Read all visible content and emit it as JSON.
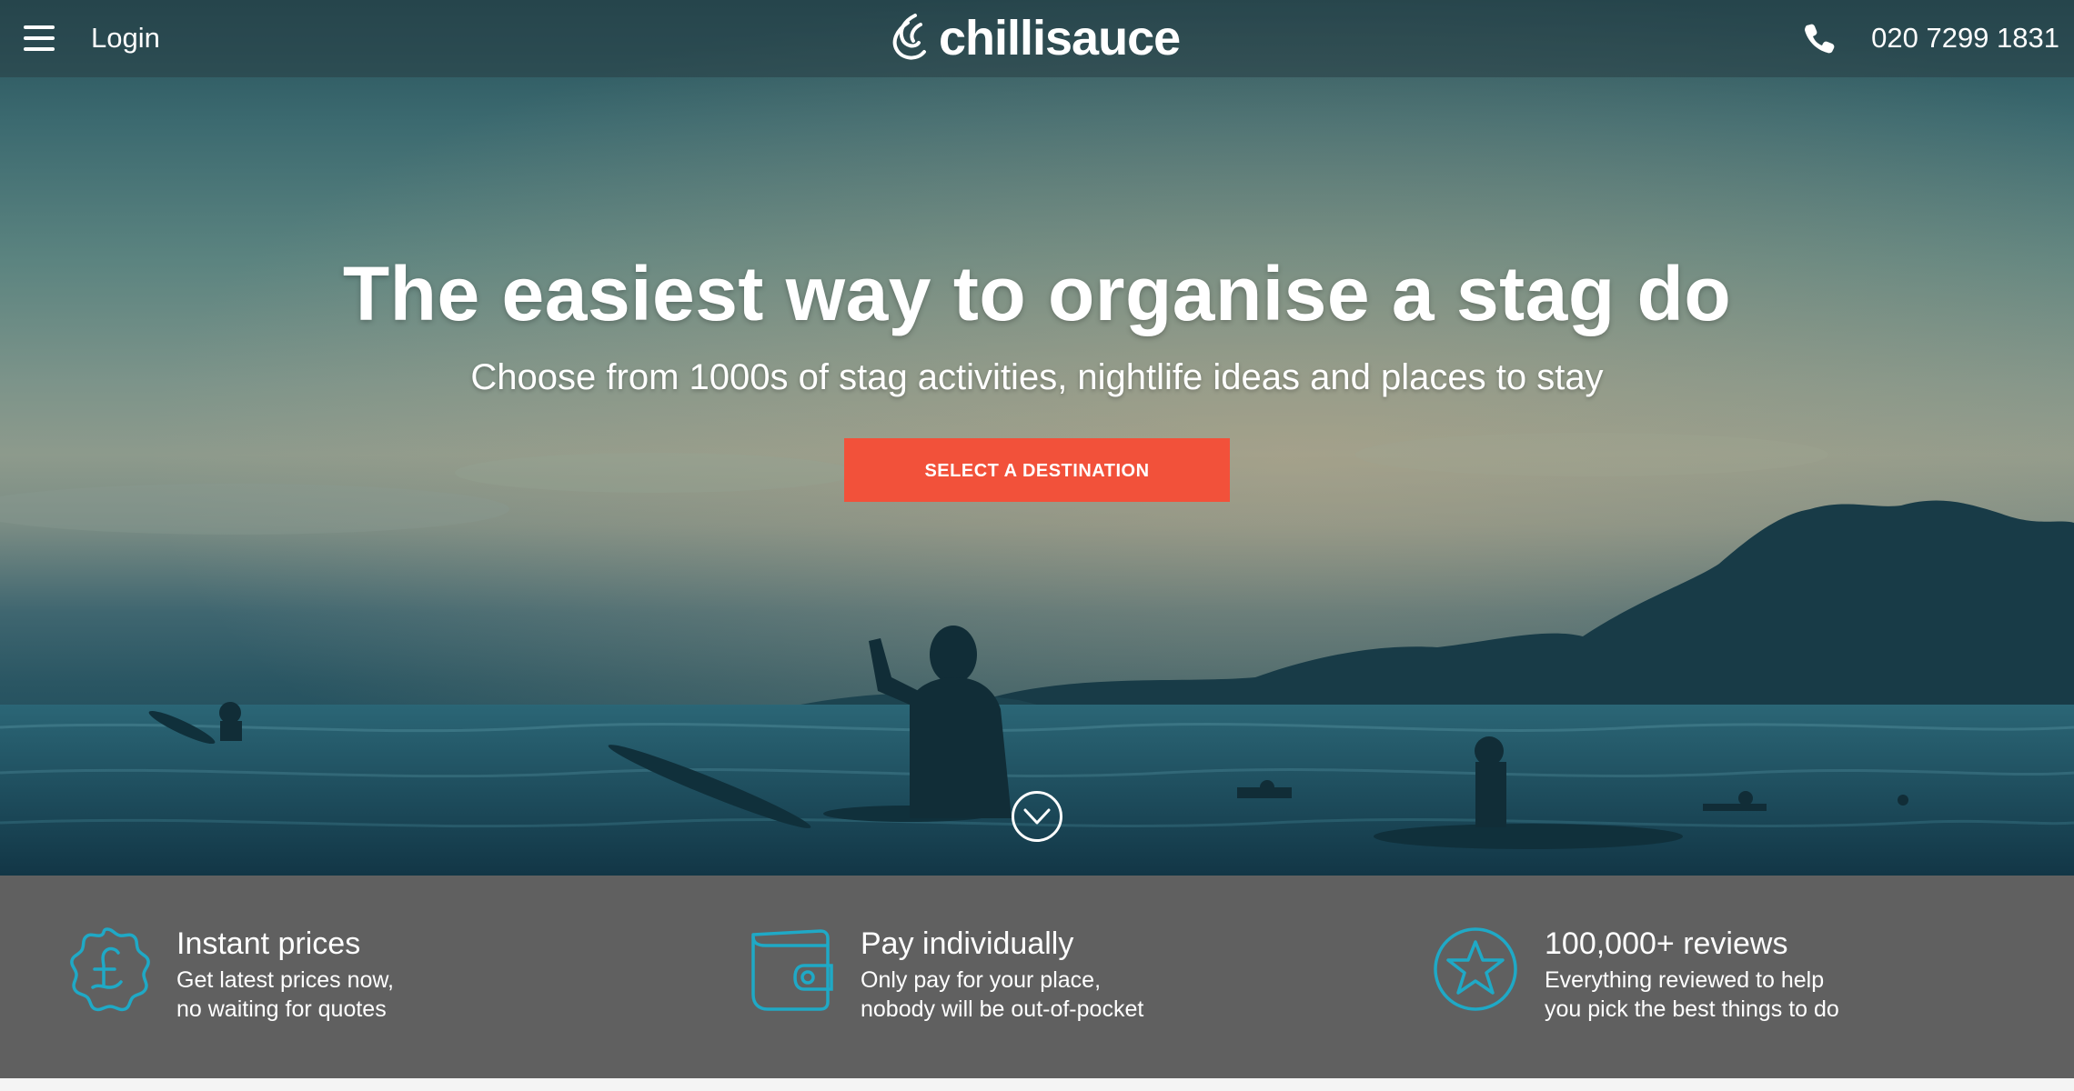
{
  "header": {
    "login_label": "Login",
    "logo_text": "chillisauce",
    "phone_number": "020 7299 1831"
  },
  "hero": {
    "title": "The easiest way to organise a stag do",
    "subtitle": "Choose from 1000s of stag activities, nightlife ideas and places to stay",
    "cta_label": "SELECT A DESTINATION"
  },
  "features": [
    {
      "icon": "pound-badge-icon",
      "title": "Instant prices",
      "desc_line1": "Get latest prices now,",
      "desc_line2": "no waiting for quotes"
    },
    {
      "icon": "wallet-icon",
      "title": "Pay individually",
      "desc_line1": "Only pay for your place,",
      "desc_line2": "nobody will be out-of-pocket"
    },
    {
      "icon": "star-circle-icon",
      "title": "100,000+ reviews",
      "desc_line1": "Everything reviewed to help",
      "desc_line2": "you pick the best things to do"
    }
  ],
  "colors": {
    "accent": "#f2513a",
    "icon_blue": "#1fa9c6",
    "features_bg": "#606060"
  }
}
